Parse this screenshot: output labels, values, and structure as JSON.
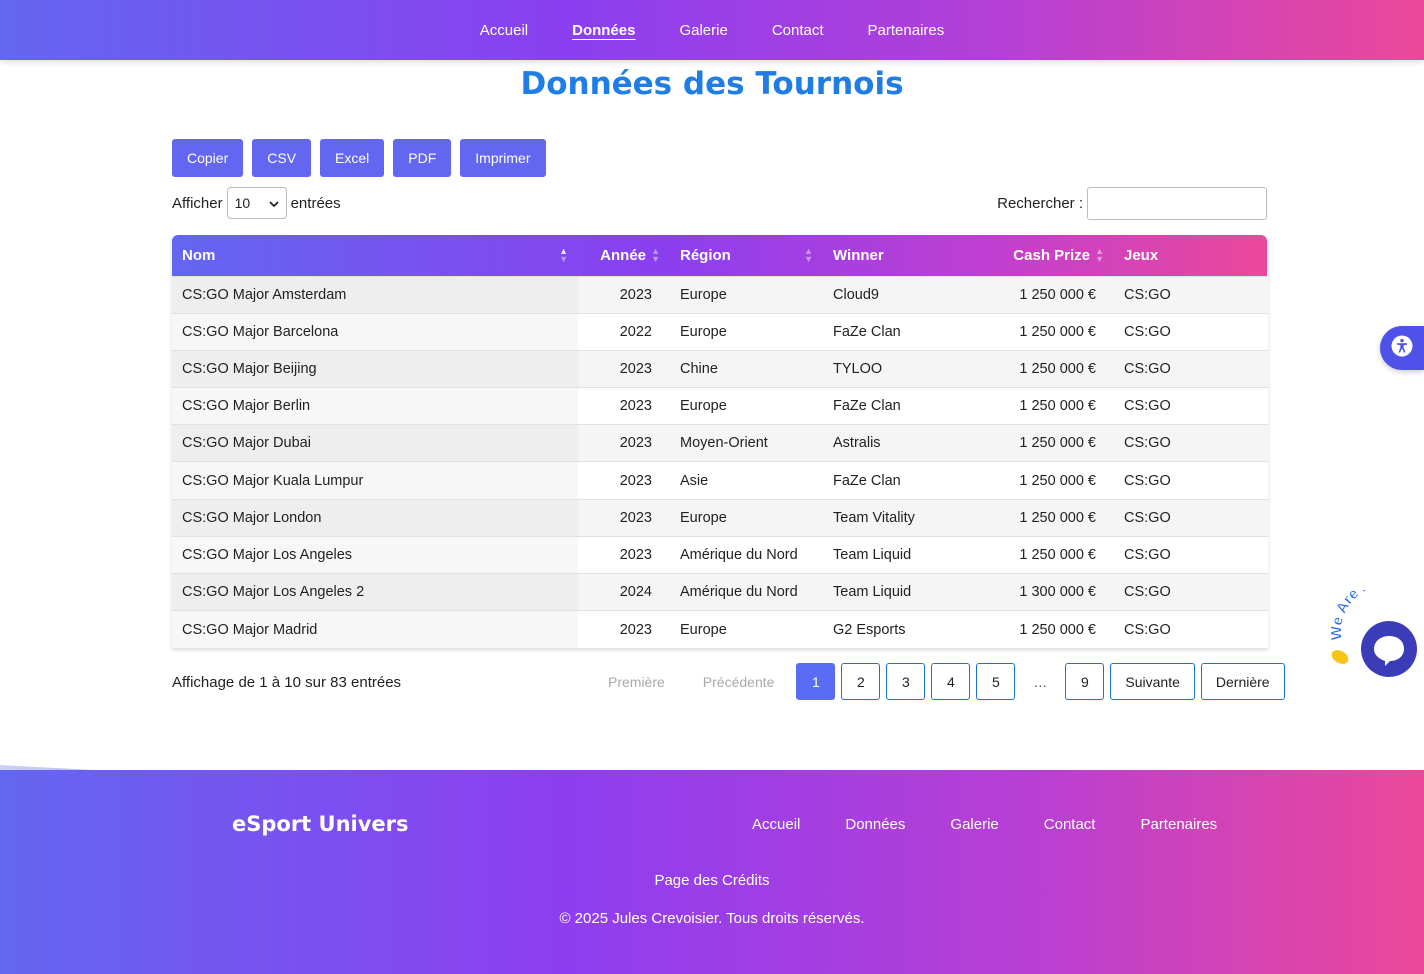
{
  "nav": {
    "items": [
      {
        "label": "Accueil",
        "active": false
      },
      {
        "label": "Données",
        "active": true
      },
      {
        "label": "Galerie",
        "active": false
      },
      {
        "label": "Contact",
        "active": false
      },
      {
        "label": "Partenaires",
        "active": false
      }
    ]
  },
  "page": {
    "title": "Données des Tournois"
  },
  "export_buttons": [
    "Copier",
    "CSV",
    "Excel",
    "PDF",
    "Imprimer"
  ],
  "length": {
    "before": "Afficher",
    "value": "10",
    "after": "entrées"
  },
  "search": {
    "label": "Rechercher :",
    "value": ""
  },
  "table": {
    "columns": [
      "Nom",
      "Année",
      "Région",
      "Winner",
      "Cash Prize",
      "Jeux"
    ],
    "rows": [
      [
        "CS:GO Major Amsterdam",
        "2023",
        "Europe",
        "Cloud9",
        "1 250 000 €",
        "CS:GO"
      ],
      [
        "CS:GO Major Barcelona",
        "2022",
        "Europe",
        "FaZe Clan",
        "1 250 000 €",
        "CS:GO"
      ],
      [
        "CS:GO Major Beijing",
        "2023",
        "Chine",
        "TYLOO",
        "1 250 000 €",
        "CS:GO"
      ],
      [
        "CS:GO Major Berlin",
        "2023",
        "Europe",
        "FaZe Clan",
        "1 250 000 €",
        "CS:GO"
      ],
      [
        "CS:GO Major Dubai",
        "2023",
        "Moyen-Orient",
        "Astralis",
        "1 250 000 €",
        "CS:GO"
      ],
      [
        "CS:GO Major Kuala Lumpur",
        "2023",
        "Asie",
        "FaZe Clan",
        "1 250 000 €",
        "CS:GO"
      ],
      [
        "CS:GO Major London",
        "2023",
        "Europe",
        "Team Vitality",
        "1 250 000 €",
        "CS:GO"
      ],
      [
        "CS:GO Major Los Angeles",
        "2023",
        "Amérique du Nord",
        "Team Liquid",
        "1 250 000 €",
        "CS:GO"
      ],
      [
        "CS:GO Major Los Angeles 2",
        "2024",
        "Amérique du Nord",
        "Team Liquid",
        "1 300 000 €",
        "CS:GO"
      ],
      [
        "CS:GO Major Madrid",
        "2023",
        "Europe",
        "G2 Esports",
        "1 250 000 €",
        "CS:GO"
      ]
    ]
  },
  "info": "Affichage de 1 à 10 sur 83 entrées",
  "pagination": {
    "first": "Première",
    "previous": "Précédente",
    "pages": [
      "1",
      "2",
      "3",
      "4",
      "5"
    ],
    "ellipsis": "…",
    "last_page": "9",
    "next": "Suivante",
    "last": "Dernière",
    "current": "1"
  },
  "footer": {
    "brand": "eSport Univers",
    "nav": [
      "Accueil",
      "Données",
      "Galerie",
      "Contact",
      "Partenaires"
    ],
    "credits": "Page des Crédits",
    "copyright": "© 2025 Jules Crevoisier. Tous droits réservés."
  },
  "chat_widget": {
    "badge": "We Are Here"
  },
  "colors": {
    "accent": "#6366f1",
    "title": "#1e7ee6",
    "gradient_end": "#ec4899"
  }
}
